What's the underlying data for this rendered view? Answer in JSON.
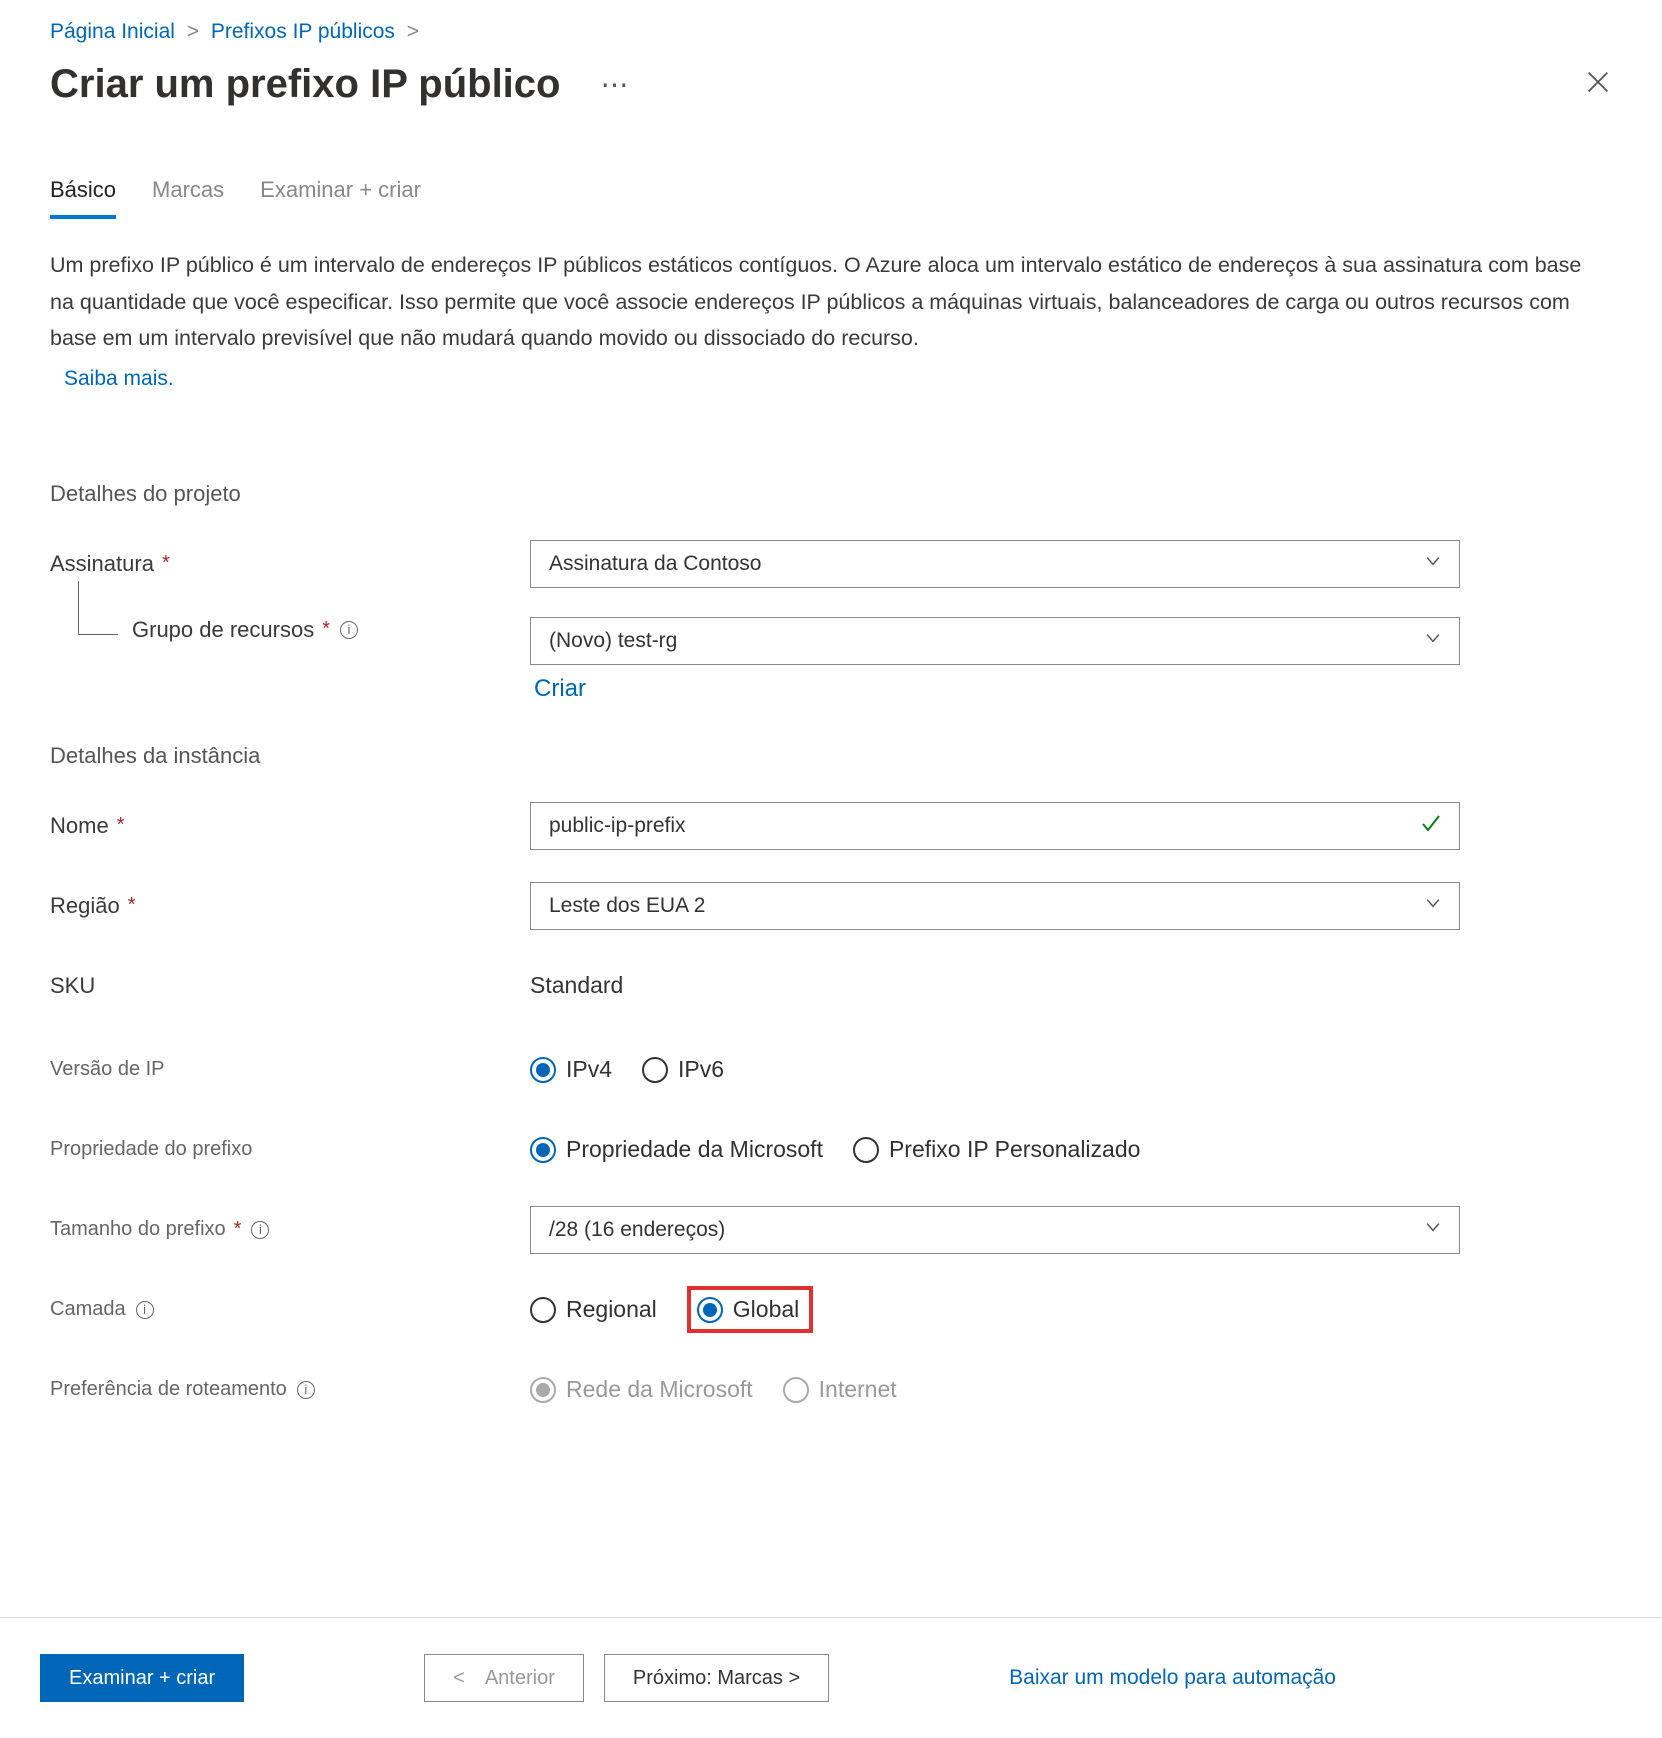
{
  "breadcrumb": {
    "home": "Página Inicial",
    "item2": "Prefixos IP públicos"
  },
  "header": {
    "title": "Criar um prefixo IP público"
  },
  "tabs": {
    "basic": "Básico",
    "tags": "Marcas",
    "review": "Examinar + criar"
  },
  "description": "Um prefixo IP público é um intervalo de endereços IP públicos estáticos contíguos. O Azure aloca um intervalo estático de endereços à sua assinatura com base na quantidade que você especificar. Isso permite que você associe endereços IP públicos a máquinas virtuais, balanceadores de carga ou outros recursos com base em um intervalo previsível que não mudará quando movido ou dissociado do recurso.",
  "learn_more": "Saiba mais.",
  "sections": {
    "project": "Detalhes do projeto",
    "instance": "Detalhes da instância"
  },
  "labels": {
    "subscription": "Assinatura",
    "resource_group": "Grupo de recursos",
    "create_new": "Criar",
    "name": "Nome",
    "region": "Região",
    "sku": "SKU",
    "ip_version": "Versão de IP",
    "prefix_ownership": "Propriedade do prefixo",
    "prefix_size": "Tamanho do prefixo",
    "tier": "Camada",
    "routing_pref": "Preferência de roteamento"
  },
  "values": {
    "subscription": "Assinatura da Contoso",
    "resource_group": "(Novo) test-rg",
    "name": "public-ip-prefix",
    "region": "Leste dos EUA 2",
    "sku": "Standard",
    "prefix_size": "/28 (16 endereços)"
  },
  "radios": {
    "ipv4": "IPv4",
    "ipv6": "IPv6",
    "ms_owned": "Propriedade da Microsoft",
    "custom_prefix": "Prefixo IP Personalizado",
    "regional": "Regional",
    "global": "Global",
    "ms_network": "Rede da Microsoft",
    "internet": "Internet"
  },
  "footer": {
    "review_create": "Examinar + criar",
    "previous": "< Anterior",
    "next": "Próximo: Marcas >",
    "download": "Baixar um modelo para automação"
  }
}
